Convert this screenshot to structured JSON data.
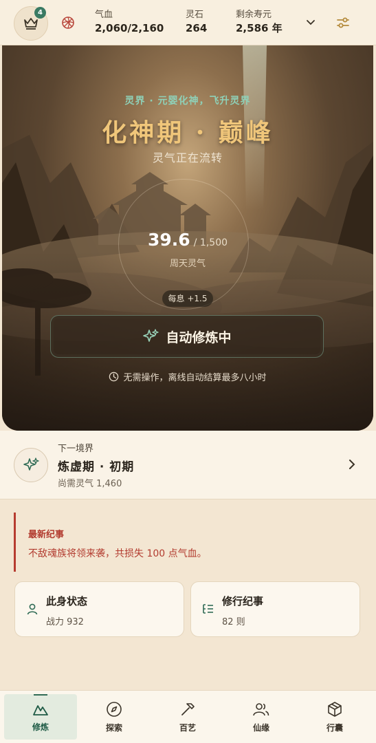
{
  "header": {
    "crown_badge": "4",
    "stats": [
      {
        "label": "气血",
        "value": "2,060/2,160"
      },
      {
        "label": "灵石",
        "value": "264"
      },
      {
        "label": "剩余寿元",
        "value": "2,586 年"
      }
    ]
  },
  "hero": {
    "subtitle": "灵界 · 元婴化神，飞升灵界",
    "realm": "化神期 · 巅峰",
    "status": "灵气正在流转",
    "qi_current": "39.6",
    "qi_total": "/ 1,500",
    "qi_label": "周天灵气",
    "rate": "每息 +1.5",
    "auto_button": "自动修炼中",
    "offline_note": "无需操作，离线自动结算最多八小时"
  },
  "next_realm": {
    "label": "下一境界",
    "name": "炼虚期 · 初期",
    "need": "尚需灵气 1,460"
  },
  "chronicle": {
    "title": "最新纪事",
    "text": "不敌魂族将领来袭，共损失 100 点气血。"
  },
  "cards": [
    {
      "title": "此身状态",
      "sub": "战力 932"
    },
    {
      "title": "修行纪事",
      "sub": "82 则"
    }
  ],
  "nav": [
    {
      "label": "修炼",
      "icon": "mountain-icon"
    },
    {
      "label": "探索",
      "icon": "compass-icon"
    },
    {
      "label": "百艺",
      "icon": "hammer-icon"
    },
    {
      "label": "仙缘",
      "icon": "users-icon"
    },
    {
      "label": "行囊",
      "icon": "box-icon"
    }
  ],
  "colors": {
    "accent": "#2f6b55",
    "alert": "#b23b2f",
    "gold": "#f0c67a"
  }
}
